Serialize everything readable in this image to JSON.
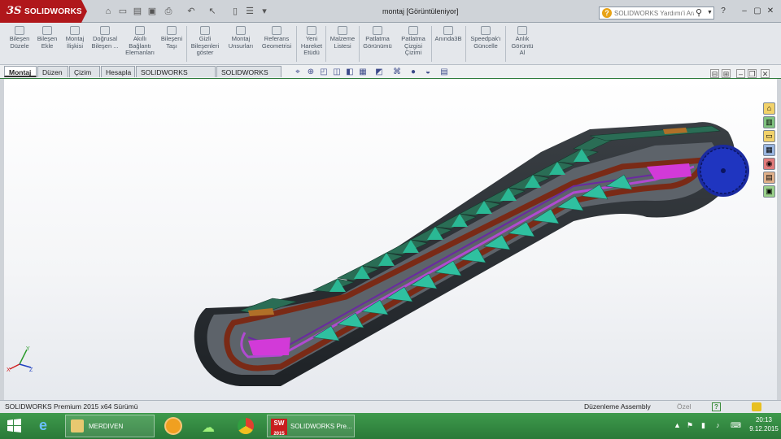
{
  "app": {
    "brand_prefix": "3S",
    "brand_name": "SOLIDWORKS",
    "window_title": "montaj [Görüntüleniyor]",
    "help_placeholder": "SOLIDWORKS Yardımı'i Ara"
  },
  "ribbon": {
    "buttons": [
      {
        "label": "Bileşen\nDüzele"
      },
      {
        "label": "Bileşen\nEkle"
      },
      {
        "label": "Montaj\nİlişkisi"
      },
      {
        "label": "Doğrusal\nBileşen ..."
      },
      {
        "label": "Akıllı\nBağlantı\nElemanları"
      },
      {
        "label": "Bileşeni\nTaşı"
      },
      {
        "label": "Gizli\nBileşenleri\ngöster"
      },
      {
        "label": "Montaj\nUnsurları"
      },
      {
        "label": "Referans\nGeometrisi"
      },
      {
        "label": "Yeni\nHareket\nEtüdü"
      },
      {
        "label": "Malzeme\nListesi"
      },
      {
        "label": "Patlatma\nGörünümü"
      },
      {
        "label": "Patlatma\nÇizgisi\nÇizimi"
      },
      {
        "label": "Anında3B"
      },
      {
        "label": "Speedpak'ı\nGüncelle"
      },
      {
        "label": "Anlık\nGörüntü\nAl"
      }
    ]
  },
  "tabs": [
    {
      "label": "Montaj"
    },
    {
      "label": "Düzen"
    },
    {
      "label": "Çizim"
    },
    {
      "label": "Hesapla"
    },
    {
      "label": "SOLIDWORKS Eklentileri"
    },
    {
      "label": "SOLIDWORKS MBD"
    }
  ],
  "triad": {
    "x": "X",
    "y": "Y",
    "z": "Z"
  },
  "status": {
    "version": "SOLIDWORKS Premium 2015 x64 Sürümü",
    "mode": "Düzenleme Assembly",
    "custom": "Özel"
  },
  "taskbar": {
    "folder_label": "MERDIVEN",
    "sw_label": "SOLIDWORKS Pre...",
    "sw_year": "2015",
    "time": "20:13",
    "date": "9.12.2015"
  },
  "colors": {
    "brand_red": "#b0171b",
    "taskbar_green": "#2d7a3a"
  }
}
